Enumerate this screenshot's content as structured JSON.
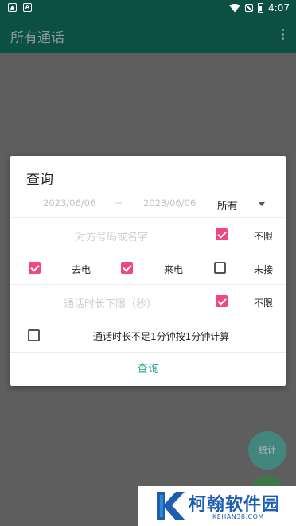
{
  "status_bar": {
    "time": "4:07",
    "left_icons": [
      "shield-icon",
      "a-icon"
    ],
    "right_icons": [
      "wifi-icon",
      "mute-icon",
      "battery-icon"
    ]
  },
  "app_bar": {
    "title": "所有通话",
    "overflow_icon": "more-vert-icon"
  },
  "dialog": {
    "title": "查询",
    "date_from": "2023/06/06",
    "date_separator": "--",
    "date_to": "2023/06/06",
    "type_filter": {
      "selected": "所有"
    },
    "contact": {
      "placeholder": "对方号码或名字",
      "unlimited_checked": true,
      "unlimited_label": "不限"
    },
    "call_types": [
      {
        "label": "去电",
        "checked": true
      },
      {
        "label": "来电",
        "checked": true
      },
      {
        "label": "未接",
        "checked": false
      }
    ],
    "duration": {
      "placeholder": "通话时长下限（秒）",
      "unlimited_checked": true,
      "unlimited_label": "不限"
    },
    "round_minute": {
      "checked": false,
      "label": "通话时长不足1分钟按1分钟计算"
    },
    "query_button": "查询"
  },
  "fab": {
    "stats_label": "统计"
  },
  "watermark": {
    "text": "柯翰软件园",
    "sub": "KEHAN38.COM"
  },
  "colors": {
    "primary_dark": "#0c4f45",
    "accent": "#f2467f",
    "button_text": "#35a99a",
    "scrim": "#5e5e5e"
  }
}
